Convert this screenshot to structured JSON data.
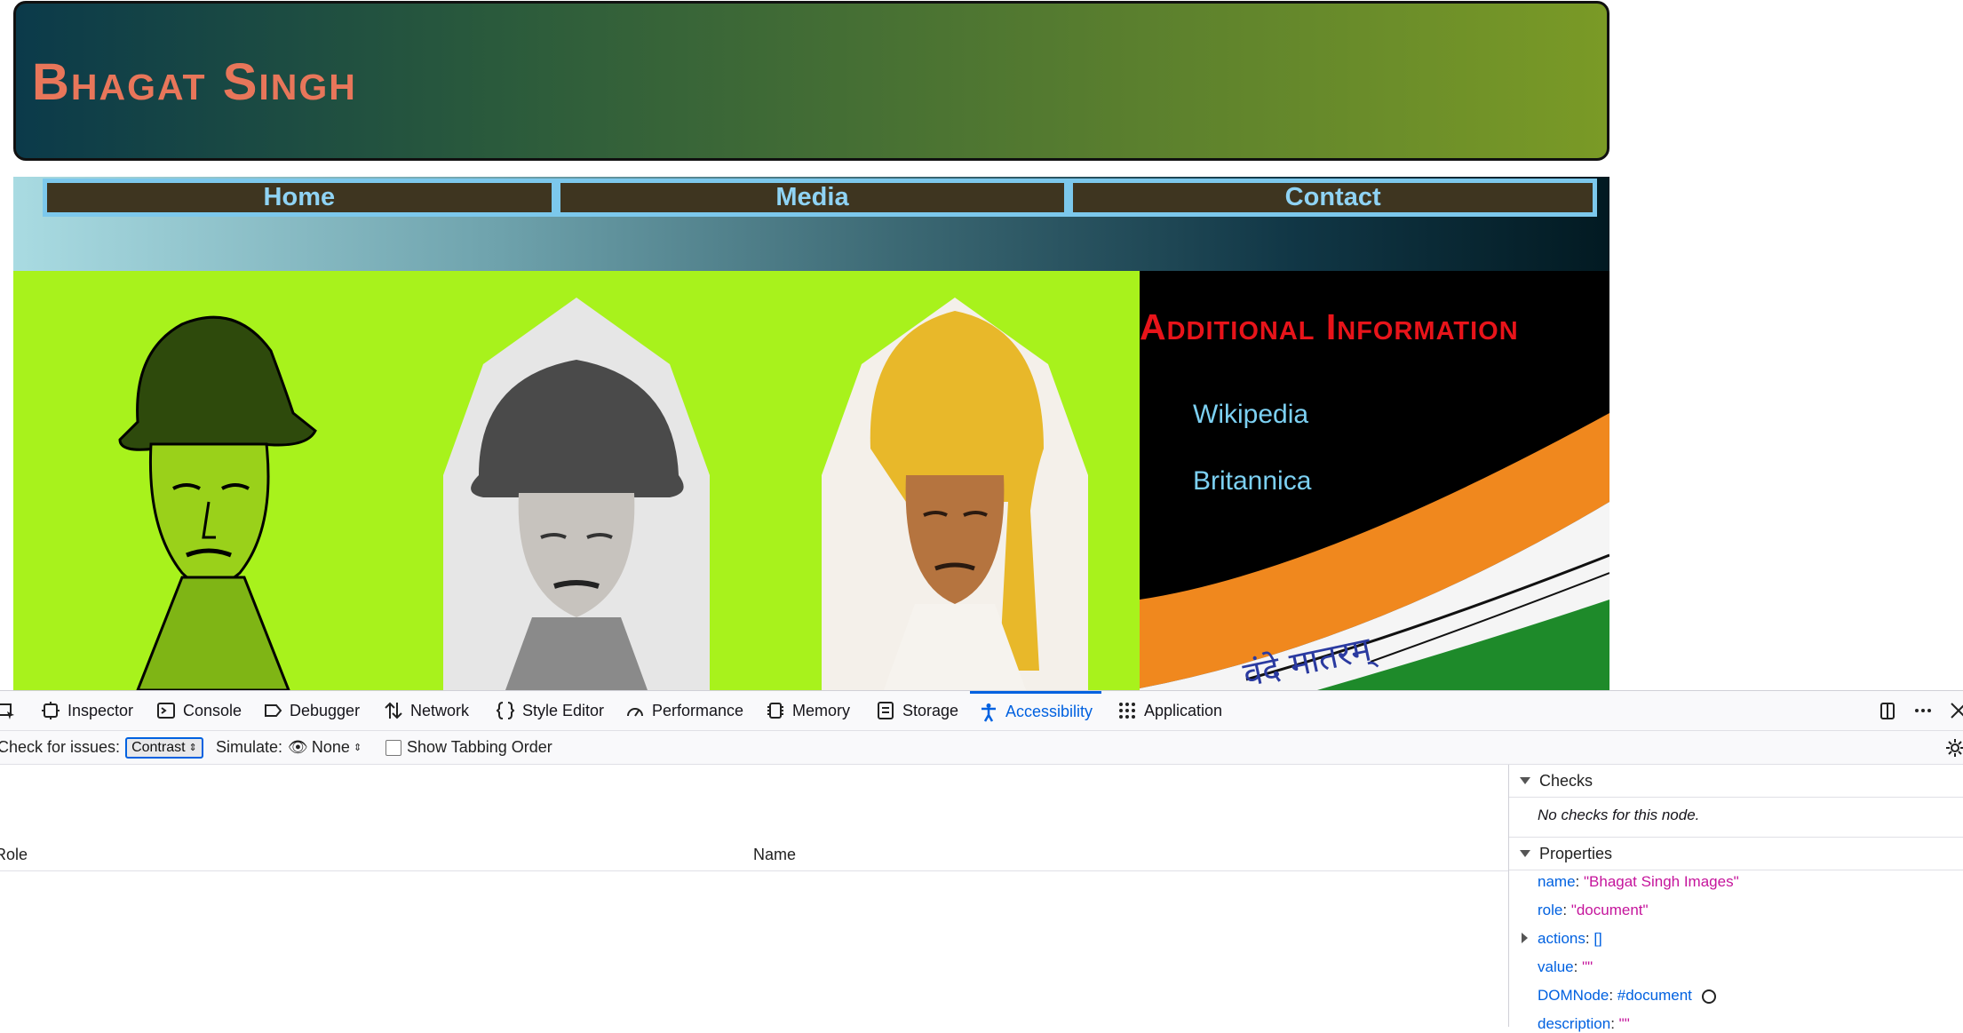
{
  "page": {
    "site_title": "Bhagat Singh",
    "nav": [
      "Home",
      "Media",
      "Contact"
    ],
    "sidebar": {
      "title": "Additional Information",
      "links": [
        "Wikipedia",
        "Britannica"
      ],
      "banner_text": "वंदे मातरम्"
    }
  },
  "devtools": {
    "tabs": [
      "Inspector",
      "Console",
      "Debugger",
      "Network",
      "Style Editor",
      "Performance",
      "Memory",
      "Storage",
      "Accessibility",
      "Application"
    ],
    "active_tab": "Accessibility",
    "check_for_issues_label": "Check for issues:",
    "check_for_issues_value": "Contrast",
    "simulate_label": "Simulate:",
    "simulate_value": "None",
    "tabbing_order_label": "Show Tabbing Order",
    "columns": {
      "role": "Role",
      "name": "Name"
    },
    "checks": {
      "title": "Checks",
      "message": "No checks for this node."
    },
    "properties": {
      "title": "Properties",
      "name_key": "name",
      "name_val": "\"Bhagat Singh Images\"",
      "role_key": "role",
      "role_val": "\"document\"",
      "actions_key": "actions",
      "actions_val": "[]",
      "value_key": "value",
      "value_val": "\"\"",
      "domnode_key": "DOMNode",
      "domnode_val": "#document",
      "description_key": "description",
      "description_val": "\"\""
    }
  },
  "colors": {
    "accent": "#0061e0",
    "title": "#e8765a",
    "sidebar_title": "#e8141a",
    "gallery_bg": "#a8f21c",
    "nav_text": "#8fd3f4"
  }
}
